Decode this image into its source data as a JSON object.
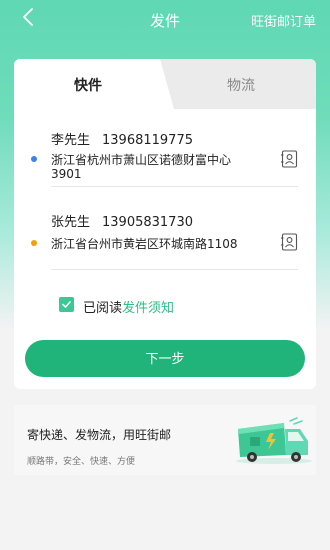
{
  "header": {
    "title": "发件",
    "right_link": "旺街邮订单"
  },
  "tabs": [
    {
      "label": "快件"
    },
    {
      "label": "物流"
    }
  ],
  "sender": {
    "name": "李先生",
    "phone": "13968119775",
    "address_line1": "浙江省杭州市萧山区诺德财富中心",
    "address_line2": "3901"
  },
  "receiver": {
    "name": "张先生",
    "phone": "13905831730",
    "address_line1": "浙江省台州市黄岩区环城南路1108"
  },
  "agreement": {
    "prefix": "已阅读",
    "link": "发件须知"
  },
  "next_button": "下一步",
  "promo": {
    "title": "寄快递、发物流，用旺街邮",
    "subtitle": "顺路带，安全、快速、方便"
  },
  "colors": {
    "brand": "#20b47a",
    "header_gradient": "#5fd8b3",
    "sender_dot": "#3b82f6",
    "receiver_dot": "#f59e0b"
  }
}
